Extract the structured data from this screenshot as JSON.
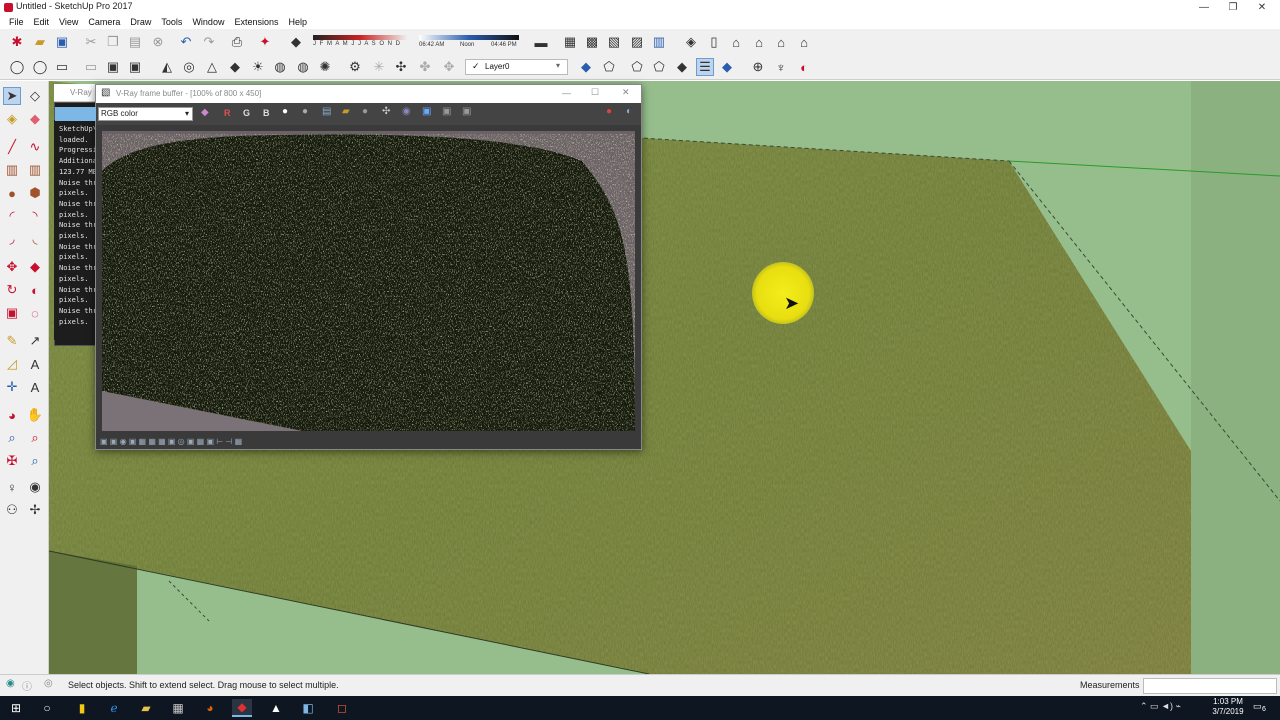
{
  "window": {
    "title": "Untitled - SketchUp Pro 2017",
    "minimize": "—",
    "maximize": "❐",
    "close": "✕"
  },
  "menu": [
    "File",
    "Edit",
    "View",
    "Camera",
    "Draw",
    "Tools",
    "Window",
    "Extensions",
    "Help"
  ],
  "toolbar": {
    "shadow_months": "J F M A M J J A S O N D",
    "shadow_time_start": "06:42 AM",
    "shadow_time_mid": "Noon",
    "shadow_time_end": "04:46 PM",
    "layer_name": "Layer0"
  },
  "vray_frame_buffer": {
    "title": "V-Ray frame buffer - [100% of 800 x 450]",
    "channel": "RGB color",
    "channel_buttons": [
      "R",
      "G",
      "B"
    ]
  },
  "vray_log": {
    "title": "V-Ray",
    "lines": [
      "SketchUp\\",
      "loaded.",
      "Progressi",
      "Additiona",
      "123.77 MB",
      "Noise thr",
      "pixels.",
      "Noise thr",
      "pixels.",
      "Noise thr",
      "pixels.",
      "Noise thr",
      "pixels.",
      "Noise thr",
      "pixels.",
      "Noise thr",
      "pixels.",
      "Noise thr",
      "pixels."
    ]
  },
  "status": {
    "hint": "Select objects. Shift to extend select. Drag mouse to select multiple.",
    "measurements_label": "Measurements",
    "measurements_value": ""
  },
  "taskbar": {
    "time": "1:03 PM",
    "date": "3/7/2019",
    "notifications": "6"
  },
  "colors": {
    "ground_plane": "#96be8c",
    "grass": "#6f7e3a",
    "highlight": "#ebe113",
    "taskbar": "#0e1621"
  }
}
